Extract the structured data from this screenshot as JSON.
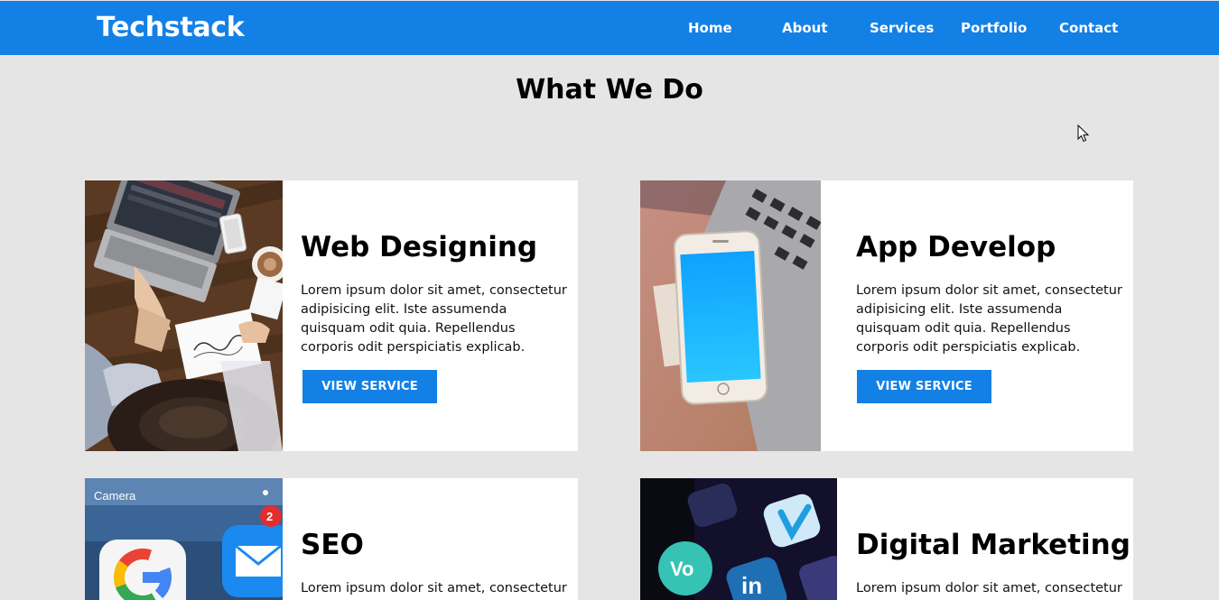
{
  "brand": "Techstack",
  "nav": {
    "home": "Home",
    "about": "About",
    "services": "Services",
    "portfolio": "Portfolio",
    "contact": "Contact"
  },
  "section_title": "What We Do",
  "cards": [
    {
      "title": "Web Designing",
      "text": "Lorem ipsum dolor sit amet, consectetur adipisicing elit. Iste assumenda quisquam odit quia. Repellendus corporis odit perspiciatis explicab.",
      "button": "VIEW SERVICE"
    },
    {
      "title": "App Develop",
      "text": "Lorem ipsum dolor sit amet, consectetur adipisicing elit. Iste assumenda quisquam odit quia. Repellendus corporis odit perspiciatis explicab.",
      "button": "VIEW SERVICE"
    },
    {
      "title": "SEO",
      "text": "Lorem ipsum dolor sit amet, consectetur"
    },
    {
      "title": "Digital Marketing",
      "text": "Lorem ipsum dolor sit amet, consectetur"
    }
  ],
  "colors": {
    "primary": "#1380e5",
    "background": "#e5e5e5",
    "card": "#ffffff"
  }
}
